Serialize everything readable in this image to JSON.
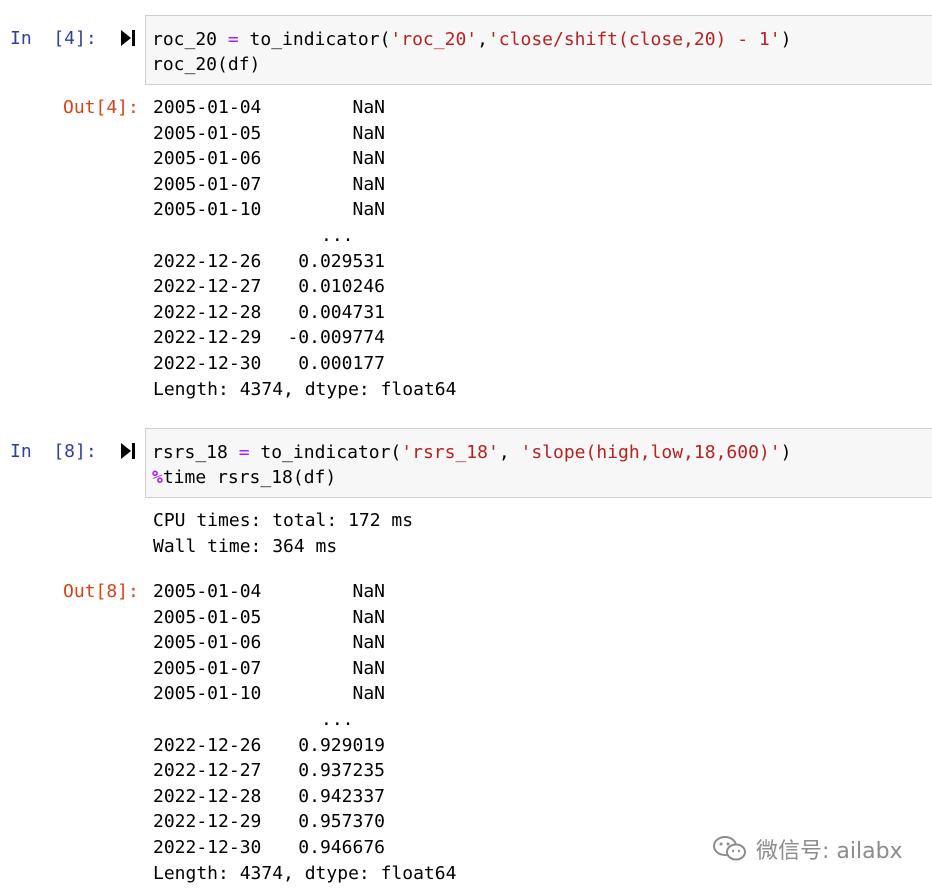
{
  "cells": [
    {
      "in_prompt": "In  [4]:",
      "code_lines": [
        [
          "roc_20 ",
          {
            "op": "="
          },
          " to_indicator(",
          {
            "str": "'roc_20'"
          },
          ",",
          {
            "str": "'close/shift(close,20) - 1'"
          },
          ")"
        ],
        [
          "roc_20(df)"
        ]
      ],
      "stdout": [],
      "out_prompt": "Out[4]:",
      "series_head": [
        {
          "date": "2005-01-04",
          "value": "NaN"
        },
        {
          "date": "2005-01-05",
          "value": "NaN"
        },
        {
          "date": "2005-01-06",
          "value": "NaN"
        },
        {
          "date": "2005-01-07",
          "value": "NaN"
        },
        {
          "date": "2005-01-10",
          "value": "NaN"
        }
      ],
      "ellipsis": "...",
      "series_tail": [
        {
          "date": "2022-12-26",
          "value": "0.029531"
        },
        {
          "date": "2022-12-27",
          "value": "0.010246"
        },
        {
          "date": "2022-12-28",
          "value": "0.004731"
        },
        {
          "date": "2022-12-29",
          "value": "-0.009774"
        },
        {
          "date": "2022-12-30",
          "value": "0.000177"
        }
      ],
      "footer": "Length: 4374, dtype: float64"
    },
    {
      "in_prompt": "In  [8]:",
      "code_lines": [
        [
          "rsrs_18 ",
          {
            "op": "="
          },
          " to_indicator(",
          {
            "str": "'rsrs_18'"
          },
          ", ",
          {
            "str": "'slope(high,low,18,600)'"
          },
          ")"
        ],
        [
          {
            "magic": "%"
          },
          "time rsrs_18(df)"
        ]
      ],
      "stdout": [
        "CPU times: total: 172 ms",
        "Wall time: 364 ms"
      ],
      "out_prompt": "Out[8]:",
      "series_head": [
        {
          "date": "2005-01-04",
          "value": "NaN"
        },
        {
          "date": "2005-01-05",
          "value": "NaN"
        },
        {
          "date": "2005-01-06",
          "value": "NaN"
        },
        {
          "date": "2005-01-07",
          "value": "NaN"
        },
        {
          "date": "2005-01-10",
          "value": "NaN"
        }
      ],
      "ellipsis": "...",
      "series_tail": [
        {
          "date": "2022-12-26",
          "value": "0.929019"
        },
        {
          "date": "2022-12-27",
          "value": "0.937235"
        },
        {
          "date": "2022-12-28",
          "value": "0.942337"
        },
        {
          "date": "2022-12-29",
          "value": "0.957370"
        },
        {
          "date": "2022-12-30",
          "value": "0.946676"
        }
      ],
      "footer": "Length: 4374, dtype: float64"
    }
  ],
  "watermark": {
    "text": "微信号: ailabx",
    "icon": "wechat-icon"
  },
  "colors": {
    "in_prompt": "#303f9f",
    "out_prompt": "#d84315",
    "operator": "#aa22ff",
    "string": "#ba2121",
    "code_bg": "#f7f7f7",
    "code_border": "#cfcfcf"
  }
}
